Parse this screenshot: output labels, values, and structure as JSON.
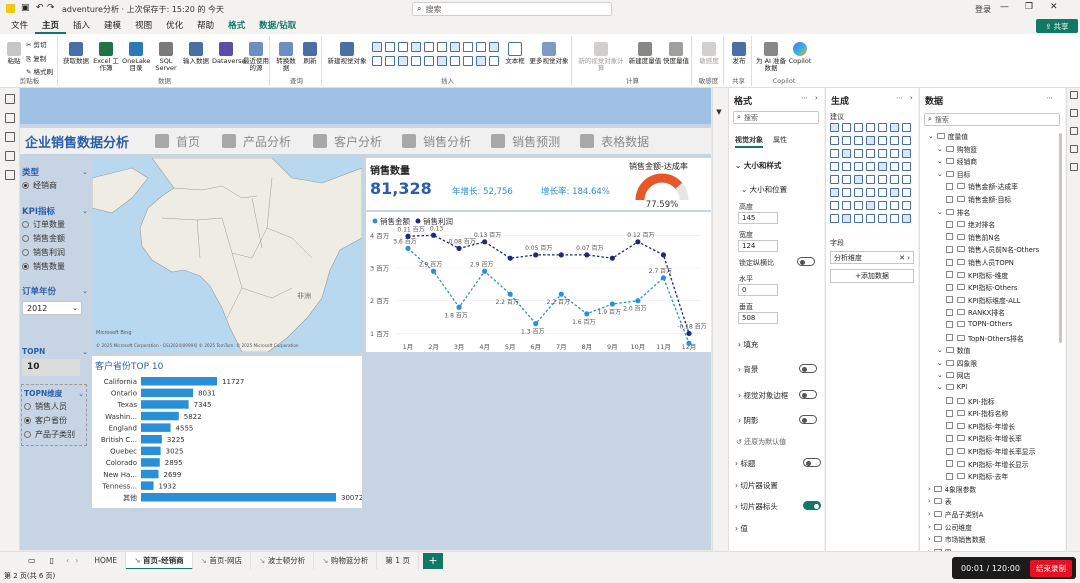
{
  "window": {
    "title": "adventure分析 · 上次保存于: 15:20 的 今天",
    "search_placeholder": "搜索",
    "signin": "登录",
    "share": "共享"
  },
  "menu": {
    "items": [
      "文件",
      "主页",
      "插入",
      "建模",
      "视图",
      "优化",
      "帮助",
      "格式",
      "数据/钻取"
    ],
    "active": "主页"
  },
  "ribbon": {
    "clipboard": {
      "paste": "粘贴",
      "cut": "剪切",
      "copy": "复制",
      "format_painter": "格式刷",
      "label": "剪贴板"
    },
    "data": {
      "items": [
        "获取数据",
        "Excel 工作簿",
        "OneLake 目录",
        "SQL Server",
        "输入数据",
        "Dataverse",
        "最近使用的源"
      ],
      "label": "数据"
    },
    "queries": {
      "items": [
        "转换数据",
        "刷新"
      ],
      "label": "查询"
    },
    "insert": {
      "items": [
        "新建视觉对象",
        "文本框",
        "更多视觉对象"
      ],
      "label": "插入"
    },
    "calc": {
      "items": [
        "新的视觉对象计算",
        "新建度量值",
        "快度量值"
      ],
      "label": "计算"
    },
    "sensitivity": {
      "items": [
        "敏感度"
      ],
      "label": "敏感度"
    },
    "share": {
      "items": [
        "发布"
      ],
      "label": "共享"
    },
    "copilot": {
      "items": [
        "为 AI 准备数据",
        "Copilot"
      ],
      "label": "Copilot"
    }
  },
  "report": {
    "nav": {
      "brand": "企业销售数据分析",
      "items": [
        "首页",
        "产品分析",
        "客户分析",
        "销售分析",
        "销售预测",
        "表格数据"
      ]
    },
    "slicers": {
      "type": {
        "title": "类型",
        "options": [
          "经销商"
        ],
        "selected": 0
      },
      "kpi": {
        "title": "KPI指标",
        "options": [
          "订单数量",
          "销售金额",
          "销售利润",
          "销售数量"
        ],
        "selected": 3
      },
      "year": {
        "title": "订单年份",
        "value": "2012"
      },
      "topn": {
        "title": "TOPN",
        "value": "10"
      },
      "topn_dim": {
        "title": "TOPN维度",
        "options": [
          "销售人员",
          "客户省份",
          "产品子类别"
        ],
        "selected": 1
      }
    },
    "map": {
      "labels": [
        "非洲"
      ],
      "attribution": "© 2025 Microsoft Corporation - GS(2024)0999号 © 2025 TomTom. © 2025 Microsoft Corporation",
      "bing": "Microsoft Bing"
    },
    "kpi": {
      "title": "销售数量",
      "value": "81,328",
      "yoy_label": "年增长",
      "yoy_value": "52,756",
      "growth_label": "增长率",
      "growth_value": "184.64%",
      "gauge_title": "销售金额-达成率",
      "gauge_value": "77.59%",
      "gauge_fraction": 0.7759
    },
    "bar_title": "客户省份TOP 10"
  },
  "chart_data": [
    {
      "type": "line",
      "categories": [
        "1月",
        "2月",
        "3月",
        "4月",
        "5月",
        "6月",
        "7月",
        "8月",
        "9月",
        "10月",
        "11月",
        "12月"
      ],
      "series": [
        {
          "name": "销售金额",
          "values": [
            3.6,
            2.9,
            1.8,
            2.9,
            2.2,
            1.3,
            2.2,
            1.6,
            1.9,
            2.0,
            2.7,
            0.7
          ],
          "labels": [
            "3.6 百万",
            "2.9 百万",
            "1.8 百万",
            "2.9 百万",
            "2.2 百万",
            "1.3 百万",
            "2.2 百万",
            "1.6 百万",
            "1.9 百万",
            "2.0 百万",
            "2.7 百万",
            ""
          ],
          "color": "#2b8fd8"
        },
        {
          "name": "销售利润",
          "values": [
            3.97,
            4.0,
            3.6,
            3.8,
            3.3,
            3.4,
            3.4,
            3.4,
            3.3,
            3.8,
            3.4,
            1.0
          ],
          "labels": [
            "0.11 百万",
            "0.13",
            "0.08 百万",
            "0.13 百万",
            "",
            "0.05 百万",
            "",
            "0.07 百万",
            "",
            "0.12 百万",
            "",
            "-0.18 百万"
          ],
          "color": "#1f2a7a"
        }
      ],
      "y_ticks": [
        "1 百万",
        "2 百万",
        "3 百万",
        "4 百万"
      ],
      "ylim": [
        0.8,
        4.1
      ],
      "legend": "top-left"
    },
    {
      "type": "bar",
      "orientation": "horizontal",
      "categories": [
        "California",
        "Ontario",
        "Texas",
        "Washin...",
        "England",
        "British C...",
        "Quebec",
        "Colorado",
        "New Ha...",
        "Tenness...",
        "其他"
      ],
      "values": [
        11727,
        8031,
        7345,
        5822,
        4555,
        3225,
        3025,
        2895,
        2699,
        1932,
        30072
      ],
      "color": "#2b8fd8"
    }
  ],
  "format_pane": {
    "title": "格式",
    "search": "搜索",
    "tabs": [
      "视觉对象",
      "属性"
    ],
    "sections": {
      "size_style": "大小和样式",
      "size_pos": "大小和位置",
      "height_label": "高度",
      "height": "145",
      "width_label": "宽度",
      "width": "124",
      "lock_ratio": "锁定纵横比",
      "horizontal_label": "水平",
      "horizontal": "0",
      "vertical_label": "垂直",
      "vertical": "508",
      "fill": "填充",
      "background": "背景",
      "border": "视觉对象边框",
      "shadow": "阴影",
      "reset": "还原为默认值",
      "title": "标题",
      "slicer_settings": "切片器设置",
      "slicer_header": "切片器标头",
      "values": "值"
    }
  },
  "build_pane": {
    "title": "生成",
    "suggest": "建议",
    "field_label": "字段",
    "field_value": "分析维度",
    "add_data": "+添加数据"
  },
  "data_pane": {
    "title": "数据",
    "search": "搜索",
    "tree": [
      {
        "level": 0,
        "label": "度量值",
        "kind": "folder"
      },
      {
        "level": 1,
        "label": "购物篮",
        "kind": "folder"
      },
      {
        "level": 1,
        "label": "经销商",
        "kind": "folder"
      },
      {
        "level": 1,
        "label": "目标",
        "kind": "folder"
      },
      {
        "level": 2,
        "label": "销售金额-达成率",
        "kind": "measure"
      },
      {
        "level": 2,
        "label": "销售金额-目标",
        "kind": "measure"
      },
      {
        "level": 1,
        "label": "排名",
        "kind": "folder"
      },
      {
        "level": 2,
        "label": "绝对排名",
        "kind": "measure"
      },
      {
        "level": 2,
        "label": "销售前N名",
        "kind": "measure"
      },
      {
        "level": 2,
        "label": "销售人员前N名-Others",
        "kind": "measure"
      },
      {
        "level": 2,
        "label": "销售人员TOPN",
        "kind": "measure"
      },
      {
        "level": 2,
        "label": "KPI指标-维度",
        "kind": "measure"
      },
      {
        "level": 2,
        "label": "KPI指标-Others",
        "kind": "measure"
      },
      {
        "level": 2,
        "label": "KPI指标维度-ALL",
        "kind": "measure"
      },
      {
        "level": 2,
        "label": "RANKX排名",
        "kind": "measure"
      },
      {
        "level": 2,
        "label": "TOPN-Others",
        "kind": "measure"
      },
      {
        "level": 2,
        "label": "TopN-Others排名",
        "kind": "measure"
      },
      {
        "level": 1,
        "label": "数值",
        "kind": "folder"
      },
      {
        "level": 1,
        "label": "四象限",
        "kind": "folder"
      },
      {
        "level": 1,
        "label": "网店",
        "kind": "folder"
      },
      {
        "level": 1,
        "label": "KPI",
        "kind": "folder"
      },
      {
        "level": 2,
        "label": "KPI-指标",
        "kind": "measure"
      },
      {
        "level": 2,
        "label": "KPI-指标名称",
        "kind": "measure"
      },
      {
        "level": 2,
        "label": "KPI指标-年增长",
        "kind": "measure"
      },
      {
        "level": 2,
        "label": "KPI指标-年增长率",
        "kind": "measure"
      },
      {
        "level": 2,
        "label": "KPI指标-年增长率显示",
        "kind": "measure"
      },
      {
        "level": 2,
        "label": "KPI指标-年增长显示",
        "kind": "measure"
      },
      {
        "level": 2,
        "label": "KPI指标-去年",
        "kind": "measure"
      },
      {
        "level": 0,
        "label": "4象限参数",
        "kind": "table"
      },
      {
        "level": 0,
        "label": "表",
        "kind": "table"
      },
      {
        "level": 0,
        "label": "产品子类别A",
        "kind": "table"
      },
      {
        "level": 0,
        "label": "公司维度",
        "kind": "table"
      },
      {
        "level": 0,
        "label": "市场销售数据",
        "kind": "table"
      },
      {
        "level": 0,
        "label": "四",
        "kind": "table"
      }
    ]
  },
  "tabs": {
    "items": [
      "HOME",
      "首页-经销商",
      "首页-网店",
      "波士顿分析",
      "购物篮分析",
      "第 1 页"
    ],
    "active": 1,
    "add": "+"
  },
  "status": {
    "page": "第 2 页(共 6 页)",
    "timer": "00:01 / 120:00",
    "record": "结束录制"
  },
  "colors": {
    "accent": "#117865",
    "brand": "#2a5ea8",
    "bar": "#2b8fd8",
    "profit": "#1f2a7a",
    "gauge": "#e8572a"
  }
}
